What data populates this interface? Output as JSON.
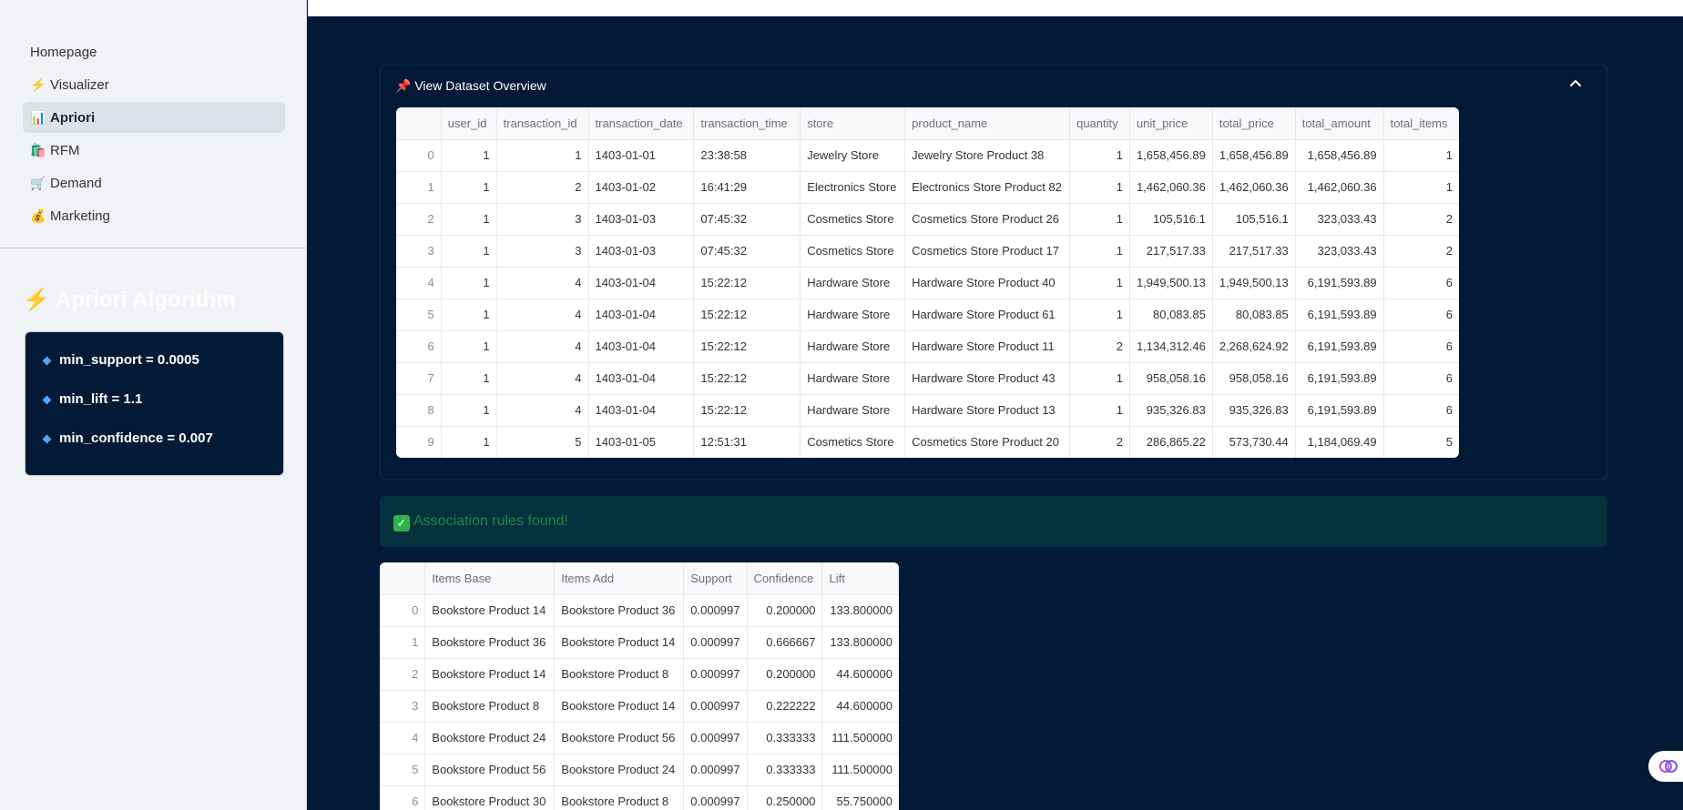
{
  "sidebar": {
    "nav": [
      {
        "icon": "",
        "label": "Homepage"
      },
      {
        "icon": "⚡",
        "label": "Visualizer"
      },
      {
        "icon": "📊",
        "label": "Apriori"
      },
      {
        "icon": "🛍️",
        "label": "RFM"
      },
      {
        "icon": "🛒",
        "label": "Demand"
      },
      {
        "icon": "💰",
        "label": "Marketing"
      }
    ],
    "active_item": "Apriori",
    "title_icon": "⚡",
    "title": "Apriori Algorithm",
    "params": [
      "min_support = 0.0005",
      "min_lift = 1.1",
      "min_confidence = 0.007"
    ]
  },
  "expander": {
    "icon": "📌",
    "label": "View Dataset Overview"
  },
  "dataset_table": {
    "columns": [
      "",
      "user_id",
      "transaction_id",
      "transaction_date",
      "transaction_time",
      "store",
      "product_name",
      "quantity",
      "unit_price",
      "total_price",
      "total_amount",
      "total_items"
    ],
    "rows": [
      [
        "0",
        "1",
        "1",
        "1403-01-01",
        "23:38:58",
        "Jewelry Store",
        "Jewelry Store Product 38",
        "1",
        "1,658,456.89",
        "1,658,456.89",
        "1,658,456.89",
        "1"
      ],
      [
        "1",
        "1",
        "2",
        "1403-01-02",
        "16:41:29",
        "Electronics Store",
        "Electronics Store Product 82",
        "1",
        "1,462,060.36",
        "1,462,060.36",
        "1,462,060.36",
        "1"
      ],
      [
        "2",
        "1",
        "3",
        "1403-01-03",
        "07:45:32",
        "Cosmetics Store",
        "Cosmetics Store Product 26",
        "1",
        "105,516.1",
        "105,516.1",
        "323,033.43",
        "2"
      ],
      [
        "3",
        "1",
        "3",
        "1403-01-03",
        "07:45:32",
        "Cosmetics Store",
        "Cosmetics Store Product 17",
        "1",
        "217,517.33",
        "217,517.33",
        "323,033.43",
        "2"
      ],
      [
        "4",
        "1",
        "4",
        "1403-01-04",
        "15:22:12",
        "Hardware Store",
        "Hardware Store Product 40",
        "1",
        "1,949,500.13",
        "1,949,500.13",
        "6,191,593.89",
        "6"
      ],
      [
        "5",
        "1",
        "4",
        "1403-01-04",
        "15:22:12",
        "Hardware Store",
        "Hardware Store Product 61",
        "1",
        "80,083.85",
        "80,083.85",
        "6,191,593.89",
        "6"
      ],
      [
        "6",
        "1",
        "4",
        "1403-01-04",
        "15:22:12",
        "Hardware Store",
        "Hardware Store Product 11",
        "2",
        "1,134,312.46",
        "2,268,624.92",
        "6,191,593.89",
        "6"
      ],
      [
        "7",
        "1",
        "4",
        "1403-01-04",
        "15:22:12",
        "Hardware Store",
        "Hardware Store Product 43",
        "1",
        "958,058.16",
        "958,058.16",
        "6,191,593.89",
        "6"
      ],
      [
        "8",
        "1",
        "4",
        "1403-01-04",
        "15:22:12",
        "Hardware Store",
        "Hardware Store Product 13",
        "1",
        "935,326.83",
        "935,326.83",
        "6,191,593.89",
        "6"
      ],
      [
        "9",
        "1",
        "5",
        "1403-01-05",
        "12:51:31",
        "Cosmetics Store",
        "Cosmetics Store Product 20",
        "2",
        "286,865.22",
        "573,730.44",
        "1,184,069.49",
        "5"
      ]
    ]
  },
  "success": {
    "icon": "✓",
    "text": "Association rules found!"
  },
  "rules_table": {
    "columns": [
      "",
      "Items Base",
      "Items Add",
      "Support",
      "Confidence",
      "Lift"
    ],
    "rows": [
      [
        "0",
        "Bookstore Product 14",
        "Bookstore Product 36",
        "0.000997",
        "0.200000",
        "133.800000"
      ],
      [
        "1",
        "Bookstore Product 36",
        "Bookstore Product 14",
        "0.000997",
        "0.666667",
        "133.800000"
      ],
      [
        "2",
        "Bookstore Product 14",
        "Bookstore Product 8",
        "0.000997",
        "0.200000",
        "44.600000"
      ],
      [
        "3",
        "Bookstore Product 8",
        "Bookstore Product 14",
        "0.000997",
        "0.222222",
        "44.600000"
      ],
      [
        "4",
        "Bookstore Product 24",
        "Bookstore Product 56",
        "0.000997",
        "0.333333",
        "111.500000"
      ],
      [
        "5",
        "Bookstore Product 56",
        "Bookstore Product 24",
        "0.000997",
        "0.333333",
        "111.500000"
      ],
      [
        "6",
        "Bookstore Product 30",
        "Bookstore Product 8",
        "0.000997",
        "0.250000",
        "55.750000"
      ]
    ]
  },
  "colors": {
    "main_bg": "#021a35",
    "sidebar_bg": "#f0f2f6",
    "success_bg": "#05313f",
    "success_text": "#1f8c3c"
  }
}
